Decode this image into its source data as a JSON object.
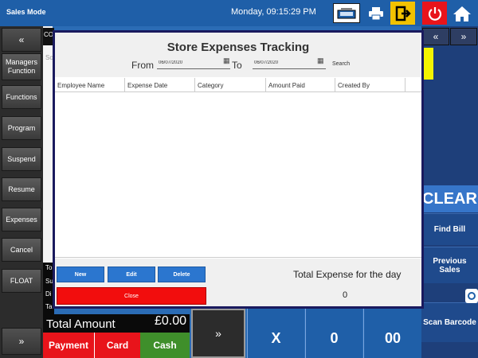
{
  "topbar": {
    "mode": "Sales Mode",
    "clock": "Monday, 09:15:29 PM",
    "icons": [
      "cash-drawer-icon",
      "printer-icon",
      "logout-icon",
      "power-icon",
      "home-icon"
    ]
  },
  "sidebar": {
    "up_arrow": "«",
    "down_arrow": "»",
    "items": [
      {
        "label": "Managers Function"
      },
      {
        "label": "Functions"
      },
      {
        "label": "Program"
      },
      {
        "label": "Suspend"
      },
      {
        "label": "Resume"
      },
      {
        "label": "Expenses"
      },
      {
        "label": "Cancel"
      },
      {
        "label": "FLOAT"
      }
    ]
  },
  "behind": {
    "co": "CO",
    "sc": "Sc",
    "t": "To",
    "su": "Su",
    "di": "Di",
    "ta": "Ta"
  },
  "right": {
    "up_arrow": "«",
    "down_arrow": "»",
    "clear": "CLEAR",
    "find_bill": "Find Bill",
    "previous_sales": "Previous Sales",
    "scan_barcode": "Scan Barcode"
  },
  "bottom": {
    "total_label": "Total Amount",
    "total_value": "£0.00",
    "payment": "Payment",
    "card": "Card",
    "cash": "Cash",
    "down_arrow": "»",
    "keys": [
      "X",
      "0",
      "00"
    ]
  },
  "modal": {
    "title": "Store Expenses Tracking",
    "from_label": "From",
    "to_label": "To",
    "from_date": "06/07/2020",
    "to_date": "06/07/2020",
    "search": "Search",
    "columns": [
      "Employee Name",
      "Expense Date",
      "Category",
      "Amount Paid",
      "Created By"
    ],
    "rows": [],
    "buttons": {
      "new": "New",
      "edit": "Edit",
      "delete": "Delete",
      "close": "Close"
    },
    "total_label": "Total Expense for the day",
    "total_value": "0"
  },
  "colors": {
    "accent_blue": "#2b76cf",
    "close_red": "#f20d0d",
    "cash_green": "#3f8f2b",
    "payment_red": "#e8141b"
  }
}
